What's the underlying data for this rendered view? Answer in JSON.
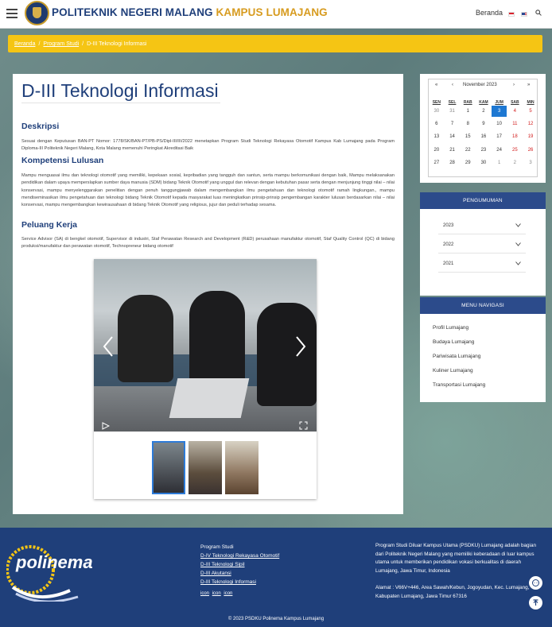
{
  "header": {
    "brand_part1": "POLITEKNIK NEGERI MALANG",
    "brand_part2": "KAMPUS LUMAJANG",
    "nav_home": "Beranda",
    "brand_color": "#1f3f7a",
    "accent_color": "#d79b1f"
  },
  "breadcrumb": {
    "items": [
      "Beranda",
      "Program Studi"
    ],
    "current": "D-III Teknologi Informasi",
    "bg_color": "#f5c514"
  },
  "main": {
    "title": "D-III Teknologi Informasi",
    "sections": [
      {
        "heading": "Deskripsi",
        "text": "Sesuai dengan Keputusan BAN-PT Nomor: 1778/SK/BAN-PT/PB-PS/Dipl-III/III/2022 menetapkan Program Studi Teknologi Rekayasa Otomotif Kampus Kab Lumajang pada Program Diploma-III Politeknik Negeri Malang, Kota Malang memenuhi Peringkat Akreditasi Baik"
      },
      {
        "heading": "Kompetensi Lulusan",
        "text": "Mampu menguasai ilmu dan teknologi otomotif yang memiliki, kepekaan sosial, kepribadian yang tangguh dan santun, serta mampu berkomunikasi dengan baik, Mampu melaksanakan pendidikan dalam upaya memperslapkan sumber daya manusia (SDM) bidang Teknik Otomotif yang unggul dan relevan dengan kebutuhan pasar serta dengan menjunjung tinggi nilai – nilai konservasi, mampu menyelenggarakan penelitian dengan penuh tanggungjawab dalam mengembangkan ilmu pengetahuan dan teknologi otomotif ramah lingkungan., mampu mendiseminasikan ilmu pengetahuan dan teknologi bidang Teknik Otomotif kepada masyarakat luas meningkatkan prinsip-prinsip pengembangan karakter lulusan berdasarkan nilai – nilai konservasi, mampu mengembangkan kewirausahaan di bidang Teknik Otomotif yang religious, jujur dan peduli terhadap sesama."
      },
      {
        "heading": "Peluang Kerja",
        "text": "Service Advisor (SA) di bengkel otomotif, Supervisor di industri, Staf Perawatan Research and Development (R&D) perusahaan manufaktur otomotif, Staf Quality Control (QC) di bidang produksi/manufaktur dan perawatan otomotif, Technopreneur bidang otomotif"
      }
    ]
  },
  "calendar": {
    "prev_year": "«",
    "prev_month": "‹",
    "month_label": "November 2023",
    "next_month": "›",
    "next_year": "»",
    "weekdays": [
      "SEN",
      "SEL",
      "RAB",
      "KAM",
      "JUM",
      "SAB",
      "MIN"
    ],
    "weeks": [
      [
        "30",
        "31",
        "1",
        "2",
        "3",
        "4",
        "5"
      ],
      [
        "6",
        "7",
        "8",
        "9",
        "10",
        "11",
        "12"
      ],
      [
        "13",
        "14",
        "15",
        "16",
        "17",
        "18",
        "19"
      ],
      [
        "20",
        "21",
        "22",
        "23",
        "24",
        "25",
        "26"
      ],
      [
        "27",
        "28",
        "29",
        "30",
        "1",
        "2",
        "3"
      ]
    ],
    "today": "3",
    "today_color": "#1e78d2",
    "weekend_color": "#d21c1c"
  },
  "pengumuman": {
    "title": "PENGUMUMAN",
    "years": [
      "2023",
      "2022",
      "2021"
    ]
  },
  "menu_navigasi": {
    "title": "MENU NAVIGASI",
    "links": [
      "Profil Lumajang",
      "Budaya Lumajang",
      "Pariwisata Lumajang",
      "Kuliner Lumajang",
      "Transportasi Lumajang"
    ]
  },
  "footer": {
    "logo_text": "polinema",
    "mid_heading": "Program Studi",
    "mid_links": [
      "D-IV Teknologi Rekayasa Otomotif",
      "D-III Teknologi Sipil",
      "D-III Akutansi",
      "D-III Teknologi Informasi"
    ],
    "icon_alts": [
      "icon",
      "icon",
      "icon"
    ],
    "about": "Program Studi Diluar Kampus Utama (PSDKU) Lumajang adalah bagian dari Politeknik Negeri Malang yang memiliki keberadaan di luar kampus utama untuk memberikan pendidikan vokasi berkualitas di daerah Lumajang, Jawa Timur, Indonesia",
    "address": "Alamat : V66V+446, Area Sawah/Kebun, Jogoyudan, Kec. Lumajang, Kabupaten Lumajang, Jawa Timur 67316",
    "copyright": "© 2023 PSDKU Polinema Kampus Lumajang",
    "bg_color": "#1f3f7a"
  }
}
